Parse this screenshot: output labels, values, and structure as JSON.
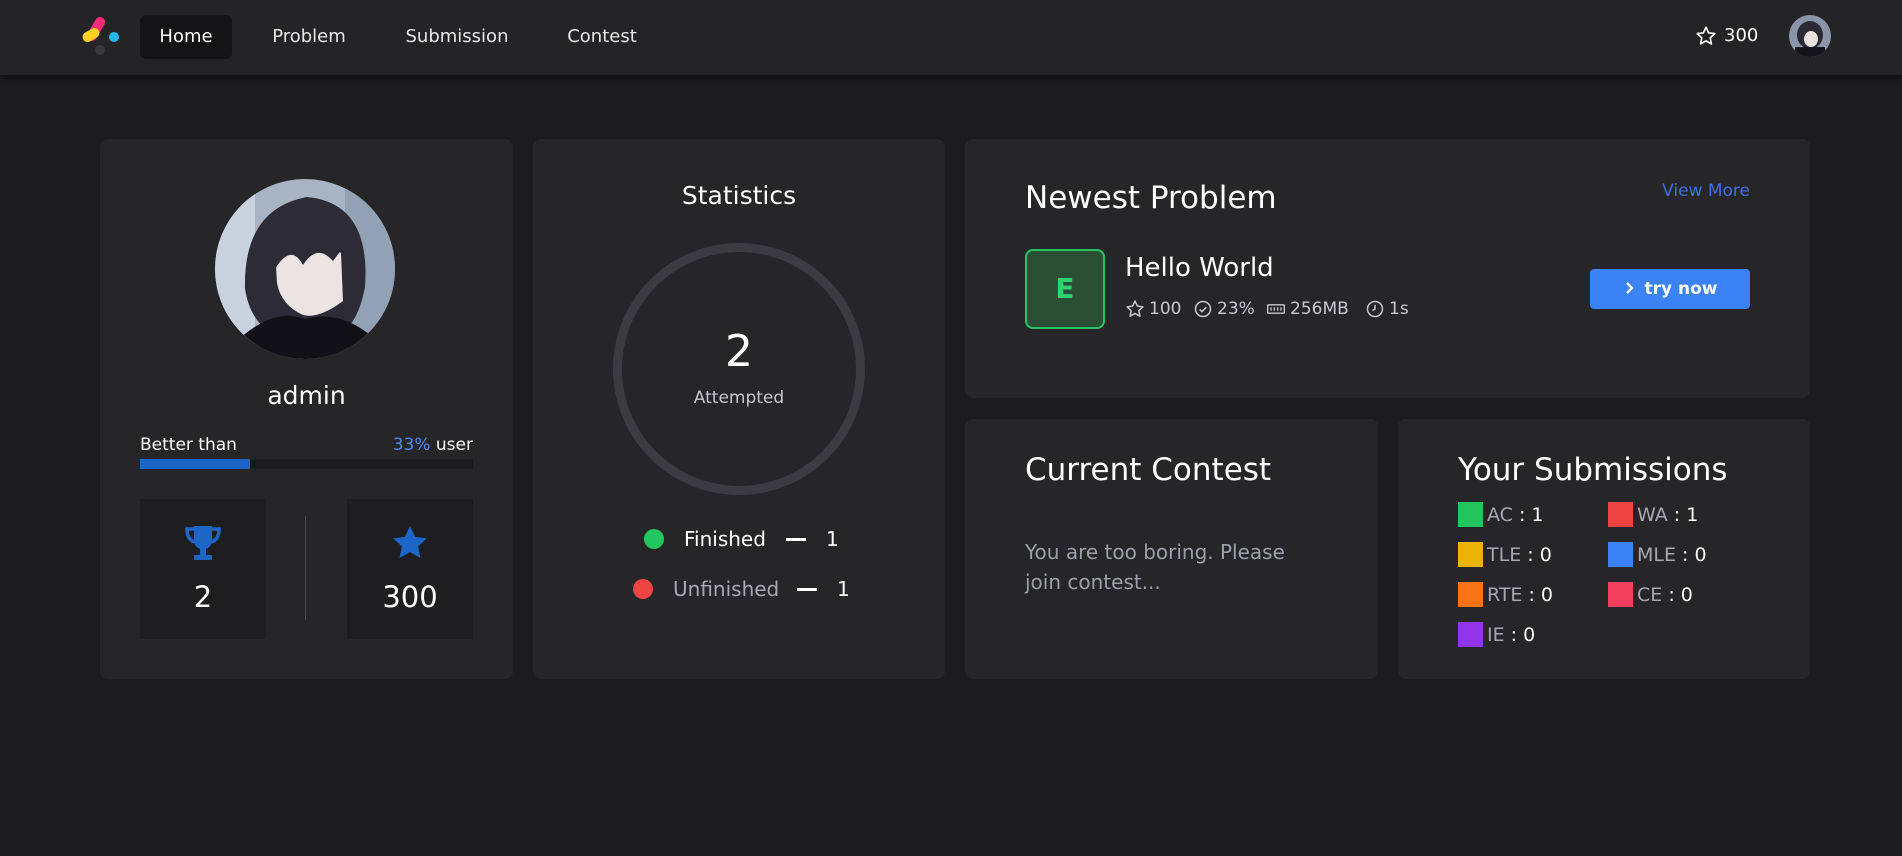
{
  "nav": {
    "items": [
      {
        "label": "Home",
        "active": true
      },
      {
        "label": "Problem",
        "active": false
      },
      {
        "label": "Submission",
        "active": false
      },
      {
        "label": "Contest",
        "active": false
      }
    ],
    "points": "300",
    "icons": {
      "star": "star-outline-icon",
      "avatar": "user-avatar"
    }
  },
  "profile": {
    "username": "admin",
    "better_than_label": "Better than",
    "better_than_percent": "33%",
    "better_than_suffix": "user",
    "progress_fraction": 0.33,
    "trophies": "2",
    "stars": "300",
    "colors": {
      "accent": "#1c66c7"
    }
  },
  "statistics": {
    "title": "Statistics",
    "attempted_count": "2",
    "attempted_label": "Attempted",
    "finished_label": "Finished",
    "finished_count": "1",
    "unfinished_label": "Unfinished",
    "unfinished_count": "1",
    "colors": {
      "finished": "#22c55e",
      "unfinished": "#ef4444"
    }
  },
  "newest_problem": {
    "title": "Newest Problem",
    "view_more": "View More",
    "difficulty_letter": "E",
    "name": "Hello World",
    "points": "100",
    "acceptance": "23%",
    "memory": "256MB",
    "time": "1s",
    "try_label": "try now"
  },
  "current_contest": {
    "title": "Current Contest",
    "message": "You are too boring. Please join contest..."
  },
  "submissions": {
    "title": "Your Submissions",
    "items": [
      {
        "label": "AC",
        "value": ": 1",
        "color": "#22c55e"
      },
      {
        "label": "WA",
        "value": ": 1",
        "color": "#ef4444"
      },
      {
        "label": "TLE",
        "value": ": 0",
        "color": "#eab308"
      },
      {
        "label": "MLE",
        "value": ": 0",
        "color": "#3b82f6"
      },
      {
        "label": "RTE",
        "value": ": 0",
        "color": "#f97316"
      },
      {
        "label": "CE",
        "value": ": 0",
        "color": "#f43f5e"
      },
      {
        "label": "IE",
        "value": ": 0",
        "color": "#9333ea"
      }
    ]
  }
}
